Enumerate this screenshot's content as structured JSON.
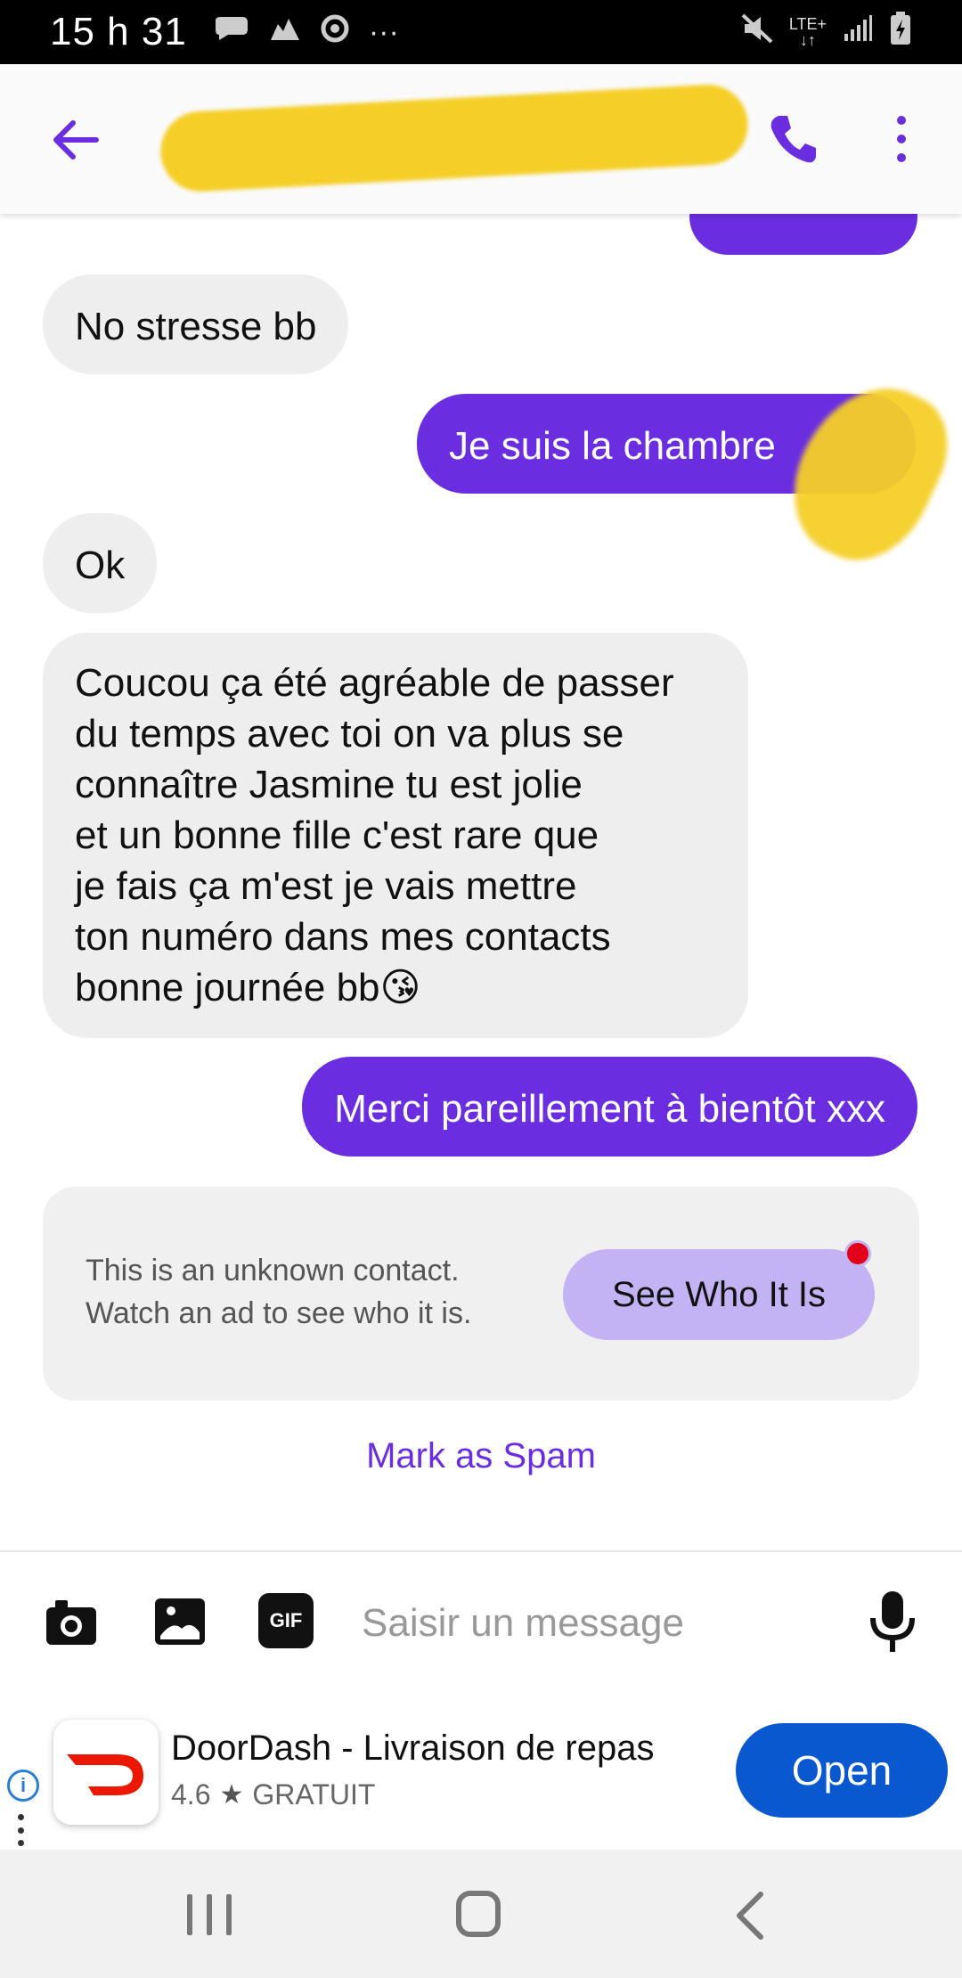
{
  "status_bar": {
    "time": "15 h 31",
    "left_icons": [
      "message-icon",
      "notification-icon",
      "chrome-icon",
      "more-notifications-icon"
    ],
    "more": "···",
    "network": "LTE+",
    "right_icons": [
      "mute-icon",
      "lte-icon",
      "signal-icon",
      "battery-charging-icon"
    ]
  },
  "header": {
    "back_icon": "arrow-back-icon",
    "contact_name_redacted": true,
    "call_icon": "phone-icon",
    "more_icon": "more-vert-icon",
    "accent": "#6a2ee0"
  },
  "messages": [
    {
      "direction": "in",
      "text": "No stresse bb"
    },
    {
      "direction": "out",
      "text": "Je suis la chambre"
    },
    {
      "direction": "in",
      "text": "Ok"
    },
    {
      "direction": "in",
      "lines": [
        "Coucou ça été agréable de passer",
        "du temps avec toi on va plus se",
        "connaître Jasmine tu est jolie",
        "et un bonne fille c'est rare que",
        "je fais ça m'est je vais mettre",
        "ton numéro dans mes contacts",
        "bonne journée bb😘"
      ]
    },
    {
      "direction": "out",
      "text": "Merci pareillement à bientôt xxx"
    }
  ],
  "unknown_contact": {
    "line1": "This is an unknown contact.",
    "line2": "Watch an ad to see who it is.",
    "button_label": "See Who It Is"
  },
  "mark_spam_label": "Mark as Spam",
  "composer": {
    "placeholder": "Saisir un message",
    "gif_label": "GIF",
    "icons": [
      "camera-icon",
      "gallery-icon",
      "gif-icon",
      "mic-icon"
    ]
  },
  "ad": {
    "title": "DoorDash - Livraison de repas",
    "rating": "4.6",
    "star": "★",
    "price": "GRATUIT",
    "button_label": "Open",
    "info_glyph": "i",
    "brand_color": "#eb1700",
    "button_color": "#0a58cf"
  },
  "navbar": {
    "icons": [
      "recent-apps-icon",
      "home-icon",
      "back-icon"
    ]
  }
}
